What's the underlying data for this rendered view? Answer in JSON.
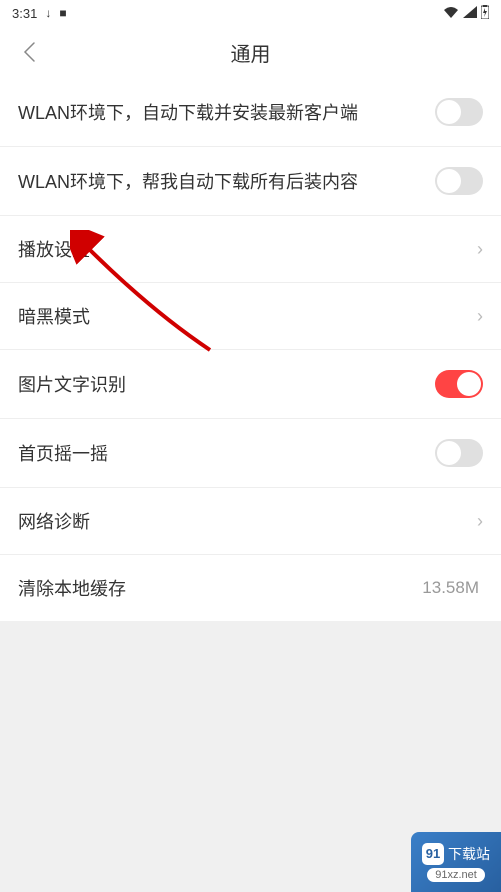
{
  "status_bar": {
    "time": "3:31",
    "download_icon": "↓",
    "app_indicator": "■"
  },
  "header": {
    "title": "通用"
  },
  "settings": [
    {
      "key": "wlan_auto_update",
      "label": "WLAN环境下，自动下载并安装最新客户端",
      "type": "toggle",
      "value": false
    },
    {
      "key": "wlan_auto_download",
      "label": "WLAN环境下，帮我自动下载所有后装内容",
      "type": "toggle",
      "value": false
    },
    {
      "key": "playback_settings",
      "label": "播放设置",
      "type": "navigate"
    },
    {
      "key": "dark_mode",
      "label": "暗黑模式",
      "type": "navigate"
    },
    {
      "key": "image_text_recognition",
      "label": "图片文字识别",
      "type": "toggle",
      "value": true
    },
    {
      "key": "shake_homepage",
      "label": "首页摇一摇",
      "type": "toggle",
      "value": false
    },
    {
      "key": "network_diagnosis",
      "label": "网络诊断",
      "type": "navigate"
    },
    {
      "key": "clear_cache",
      "label": "清除本地缓存",
      "type": "value",
      "value_text": "13.58M"
    }
  ],
  "watermark": {
    "badge": "91",
    "text": "下载站",
    "url": "91xz.net"
  },
  "colors": {
    "toggle_on": "#ff4444",
    "toggle_off": "#e0e0e0",
    "arrow": "#d00000"
  }
}
